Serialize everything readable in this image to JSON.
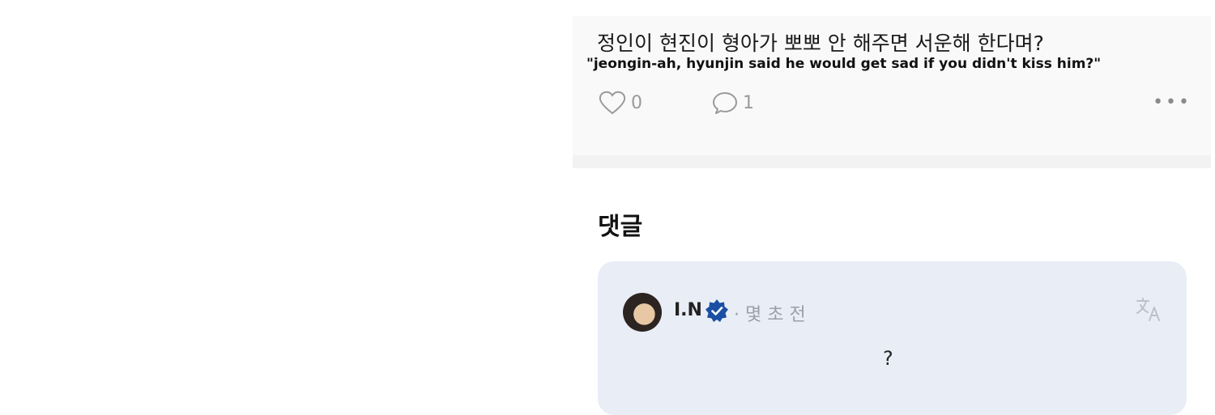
{
  "post": {
    "korean_text": "정인이 현진이 형아가 뽀뽀 안 해주면 서운해 한다며?",
    "english_caption": "\"jeongin-ah, hyunjin said he would get sad if you didn't kiss him?\"",
    "like_count": "0",
    "comment_count": "1",
    "more_label": "•••"
  },
  "comments": {
    "title": "댓글",
    "items": [
      {
        "author": "I.N",
        "meta": "· 몇 초 전",
        "text": "?"
      }
    ]
  },
  "colors": {
    "icon_gray": "#9a9a9a",
    "verified_blue": "#1a4fa3",
    "comment_bg": "#e9edf6"
  }
}
